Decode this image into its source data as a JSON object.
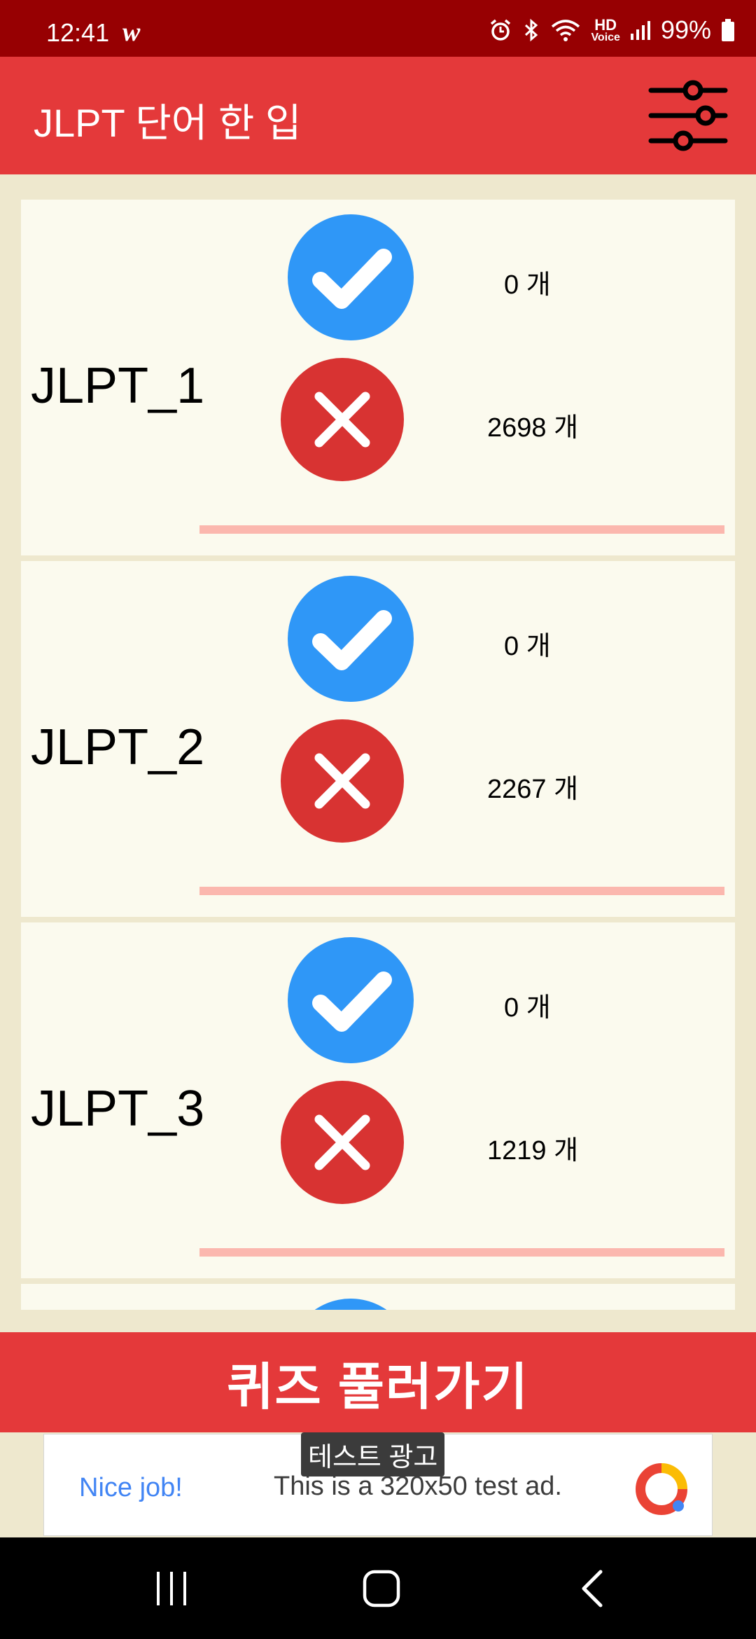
{
  "status": {
    "time": "12:41",
    "carrier_icon": "w",
    "battery": "99%",
    "icons": [
      "alarm-icon",
      "bluetooth-icon",
      "wifi-icon",
      "hd-voice-icon",
      "signal-icon",
      "battery-icon"
    ],
    "hd_top": "HD",
    "hd_bottom": "Voice"
  },
  "appbar": {
    "title": "JLPT 단어 한 입",
    "filter_icon": "sliders-icon"
  },
  "cards": [
    {
      "label": "JLPT_1",
      "correct": "0 개",
      "wrong": "2698 개"
    },
    {
      "label": "JLPT_2",
      "correct": "0 개",
      "wrong": "2267 개"
    },
    {
      "label": "JLPT_3",
      "correct": "0 개",
      "wrong": "1219 개"
    }
  ],
  "quiz_button": "퀴즈 풀러가기",
  "ad": {
    "tag": "테스트 광고",
    "nice": "Nice job!",
    "text": "This is a 320x50 test ad."
  },
  "colors": {
    "primary": "#E4393A",
    "status": "#970002",
    "background": "#EEE8CE",
    "card": "#FBFAEE",
    "progress": "#FBB7AE",
    "check": "#2F97F7",
    "cross": "#D83332"
  }
}
